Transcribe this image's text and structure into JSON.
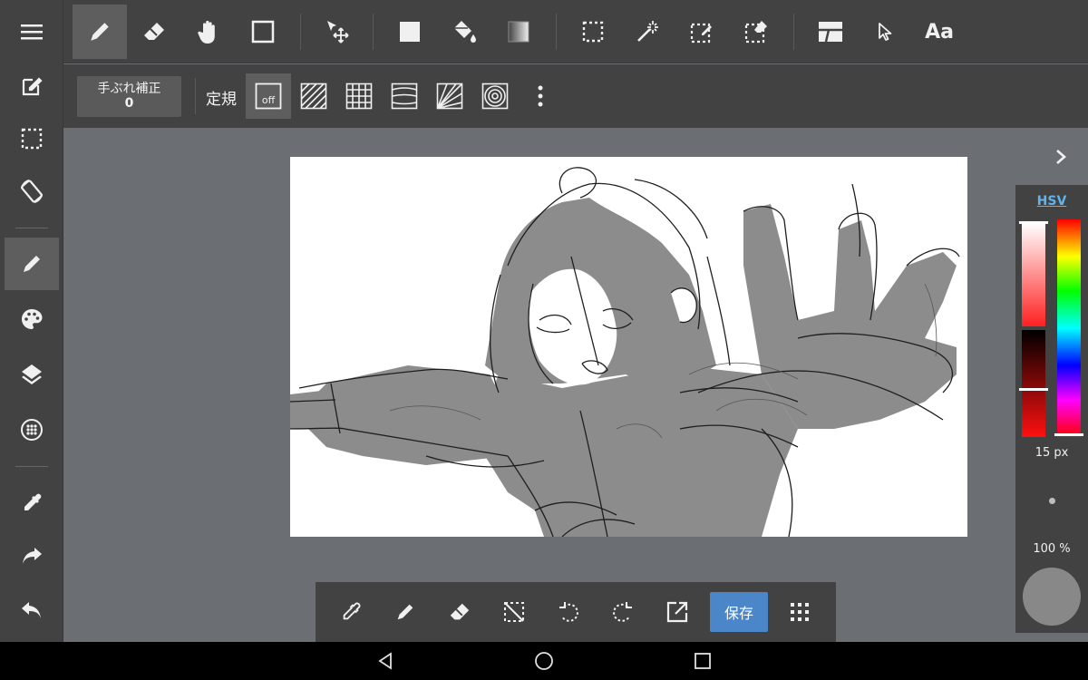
{
  "toolbar": {
    "tools": [
      "pen-icon",
      "eraser-icon",
      "hand-icon",
      "shape-icon",
      "move-icon",
      "fill-rect-icon",
      "bucket-icon",
      "gradient-icon",
      "select-icon",
      "magic-wand-icon",
      "select-pen-icon",
      "select-eraser-icon",
      "frame-divider-icon",
      "pointer-icon",
      "text-tool-icon"
    ],
    "text_tool_label": "Aa"
  },
  "subbar": {
    "stabilizer_label": "手ぶれ補正",
    "stabilizer_value": "0",
    "ruler_label": "定規",
    "ruler_off_label": "off"
  },
  "sidebar": {
    "items": [
      "menu-icon",
      "edit-icon",
      "selection-icon",
      "rotate-icon",
      "brush-icon",
      "palette-icon",
      "layers-icon",
      "materials-icon",
      "eyedropper-icon",
      "redo-icon",
      "undo-icon"
    ]
  },
  "color_panel": {
    "mode_label": "HSV",
    "brush_size": "15 px",
    "opacity": "100 %",
    "current_color": "#888888",
    "accent": "#5fb4f0"
  },
  "bottombar": {
    "save_label": "保存"
  },
  "colors": {
    "toolbar_bg": "#424242",
    "workspace_bg": "#6b6f74",
    "save_button": "#4a86c8"
  }
}
